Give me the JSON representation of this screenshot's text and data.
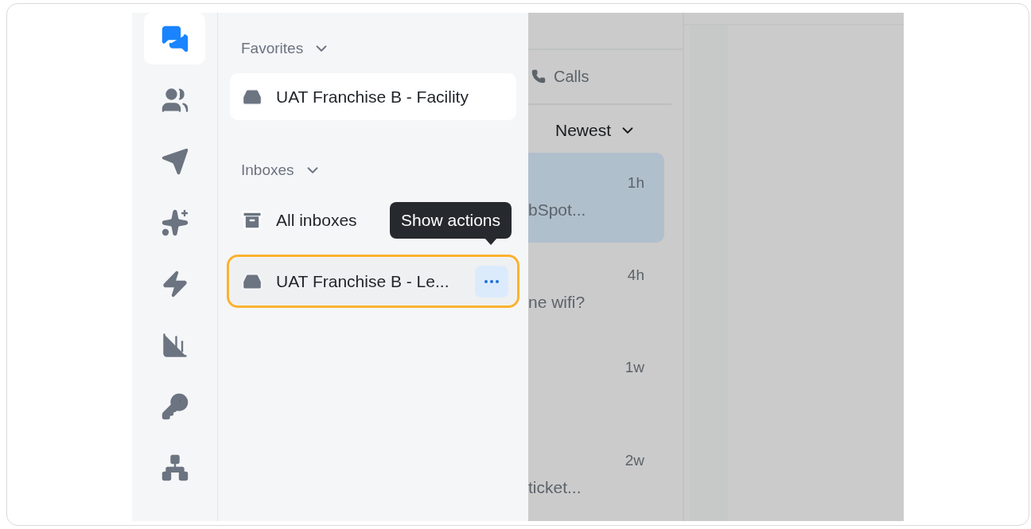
{
  "rail": {
    "items": [
      {
        "kind": "chats",
        "selected": true
      },
      {
        "kind": "contacts",
        "selected": false
      },
      {
        "kind": "send",
        "selected": false
      },
      {
        "kind": "sparkle",
        "selected": false
      },
      {
        "kind": "bolt",
        "selected": false
      },
      {
        "kind": "reports",
        "selected": false
      },
      {
        "kind": "key",
        "selected": false
      },
      {
        "kind": "network",
        "selected": false
      }
    ]
  },
  "nav": {
    "sections": [
      {
        "kind": "favorites",
        "title": "Favorites",
        "expanded": true,
        "items": [
          {
            "label": "UAT Franchise B - Facility",
            "kind": "inbox",
            "selected": false
          }
        ]
      },
      {
        "kind": "inboxes",
        "title": "Inboxes",
        "expanded": true,
        "items": [
          {
            "label": "All inboxes",
            "kind": "all",
            "selected": false
          },
          {
            "label": "UAT Franchise B - Le...",
            "kind": "inbox",
            "selected": true
          }
        ]
      }
    ],
    "tooltip": "Show actions"
  },
  "list": {
    "tab": "Calls",
    "sort": "Newest",
    "conversations": [
      {
        "time": "1h",
        "preview": "bSpot...",
        "selected": true
      },
      {
        "time": "4h",
        "preview": "ne wifi?",
        "selected": false
      },
      {
        "time": "1w",
        "selected": false
      },
      {
        "time": "2w",
        "preview": "ticket...",
        "selected": false
      }
    ]
  }
}
